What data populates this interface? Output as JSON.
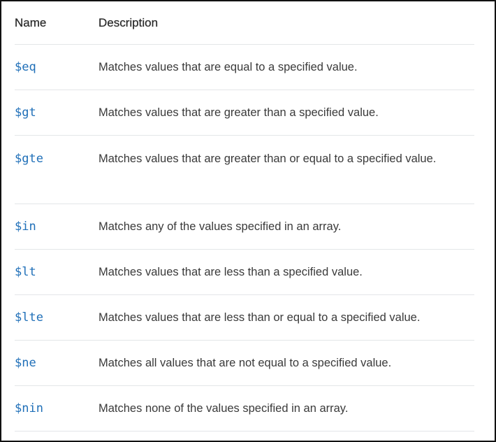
{
  "header": {
    "name": "Name",
    "description": "Description"
  },
  "rows": [
    {
      "name": "$eq",
      "description": "Matches values that are equal to a specified value."
    },
    {
      "name": "$gt",
      "description": "Matches values that are greater than a specified value."
    },
    {
      "name": "$gte",
      "description": "Matches values that are greater than or equal to a specified value."
    },
    {
      "name": "$in",
      "description": "Matches any of the values specified in an array."
    },
    {
      "name": "$lt",
      "description": "Matches values that are less than a specified value."
    },
    {
      "name": "$lte",
      "description": "Matches values that are less than or equal to a specified value."
    },
    {
      "name": "$ne",
      "description": "Matches all values that are not equal to a specified value."
    },
    {
      "name": "$nin",
      "description": "Matches none of the values specified in an array."
    }
  ]
}
